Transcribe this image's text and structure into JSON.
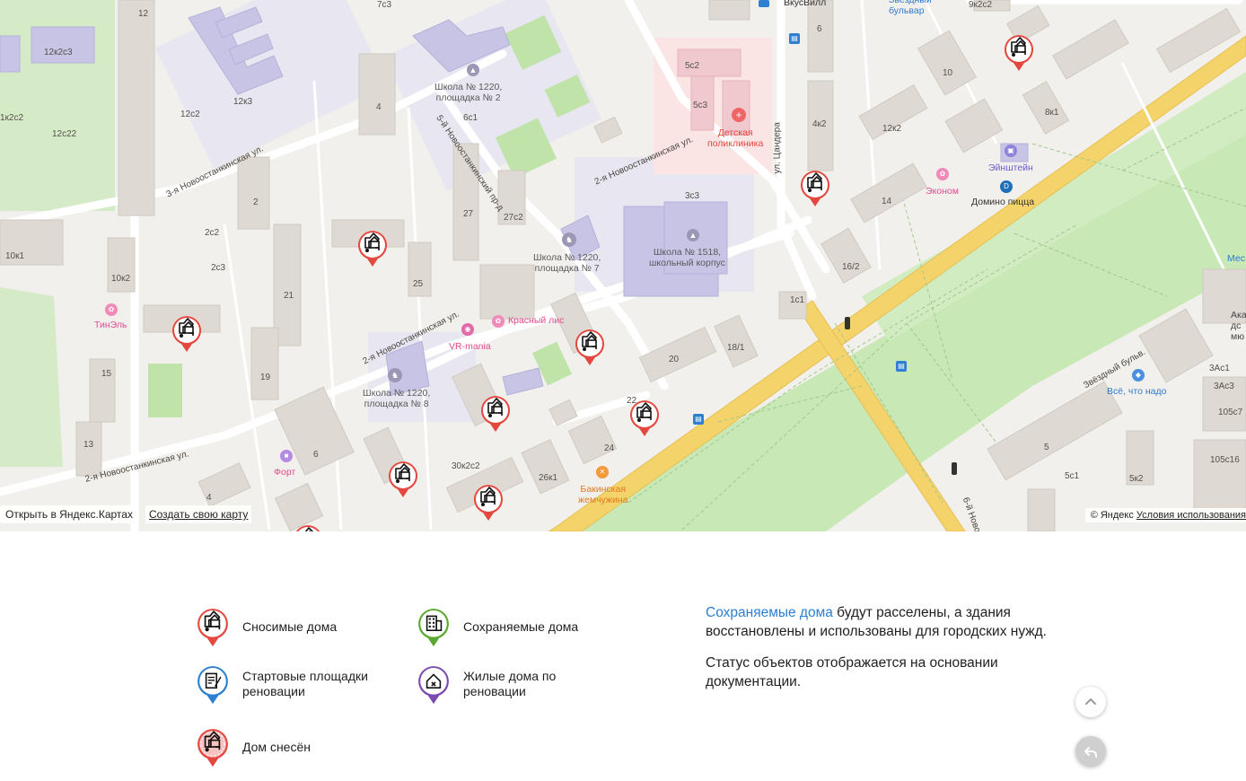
{
  "map": {
    "open_in_yandex": "Открыть в Яндекс.Картах",
    "create_map": "Создать свою карту",
    "copyright": "© Яндекс",
    "terms": "Условия использования",
    "streets": {
      "s1": "3-я Новоостанкинская ул.",
      "s2": "2-я Новоостанкинская ул.",
      "s3": "2-я Новоостанкинская ул.",
      "s4": "5-й Новоостанкинский пр-д",
      "s5": "2-я Новоостанкинская ул.",
      "s6": "ул. Цандера",
      "s7": "Звёздный бульв.",
      "s8": "6-й Ново"
    },
    "pois": {
      "school_2": "Школа № 1220,\nплощадка № 2",
      "school_7": "Школа № 1220,\nплощадка № 7",
      "school_8": "Школа № 1220,\nплощадка № 8",
      "school_1518": "Школа № 1518,\nшкольный корпус",
      "clinic": "Детская\nполиклиника",
      "tinel": "ТинЭль",
      "krasny_lis": "Красный лис",
      "vrmania": "VR-mania",
      "fort": "Форт",
      "bakinskaya": "Бакинская\nжемчужина",
      "einstein": "Эйнштейн",
      "ekonom": "Эконом",
      "domino": "Домино пицца",
      "vse_nado": "Всё, что надо",
      "vkusvill": "ВкусВилл",
      "zvezdny": "Звёздный\nбульвар",
      "mes": "Мес",
      "aka": "Ака\nдс\nмю"
    },
    "house_numbers": [
      "12",
      "12к2с3",
      "1к2с2",
      "12с22",
      "12к3",
      "12с2",
      "4",
      "2",
      "2с2",
      "2с3",
      "10к1",
      "10к2",
      "21",
      "15",
      "19",
      "13",
      "25",
      "27",
      "27с2",
      "6с1",
      "5с2",
      "5с3",
      "6",
      "4к2",
      "3с3",
      "10",
      "12к2",
      "8к1",
      "14",
      "16/2",
      "1с1",
      "20",
      "18/1",
      "24",
      "26к1",
      "30к2с2",
      "6",
      "4",
      "5",
      "5с1",
      "5к2",
      "3Ас1",
      "3Ас3",
      "105с7",
      "105с16",
      "7с3",
      "9к2с2",
      "22"
    ]
  },
  "legend": {
    "demolished_label": "Сносимые дома",
    "preserved_label": "Сохраняемые дома",
    "start_sites_label": "Стартовые площадки реновации",
    "renovation_homes_label": "Жилые дома по реновации",
    "demolished_done_label": "Дом снесён"
  },
  "info": {
    "p1_accent": "Сохраняемые дома",
    "p1_rest": " будут расселены, а здания восстановлены и использованы для городских нужд.",
    "p2": "Статус объектов отображается на основании документации."
  },
  "colors": {
    "demolish_pin": "#e4473e",
    "preserve_pin": "#5aa82e",
    "start_pin": "#2c7fd1",
    "renovation_pin": "#7b4bb0",
    "road_major": "#f4d36b",
    "park": "#c8e8b5",
    "accent_link": "#2c7fd1"
  },
  "icons": {
    "pin_icon": "excavator-pin-icon",
    "scroll_up": "chevron-up-icon",
    "back": "undo-arrow-icon"
  }
}
